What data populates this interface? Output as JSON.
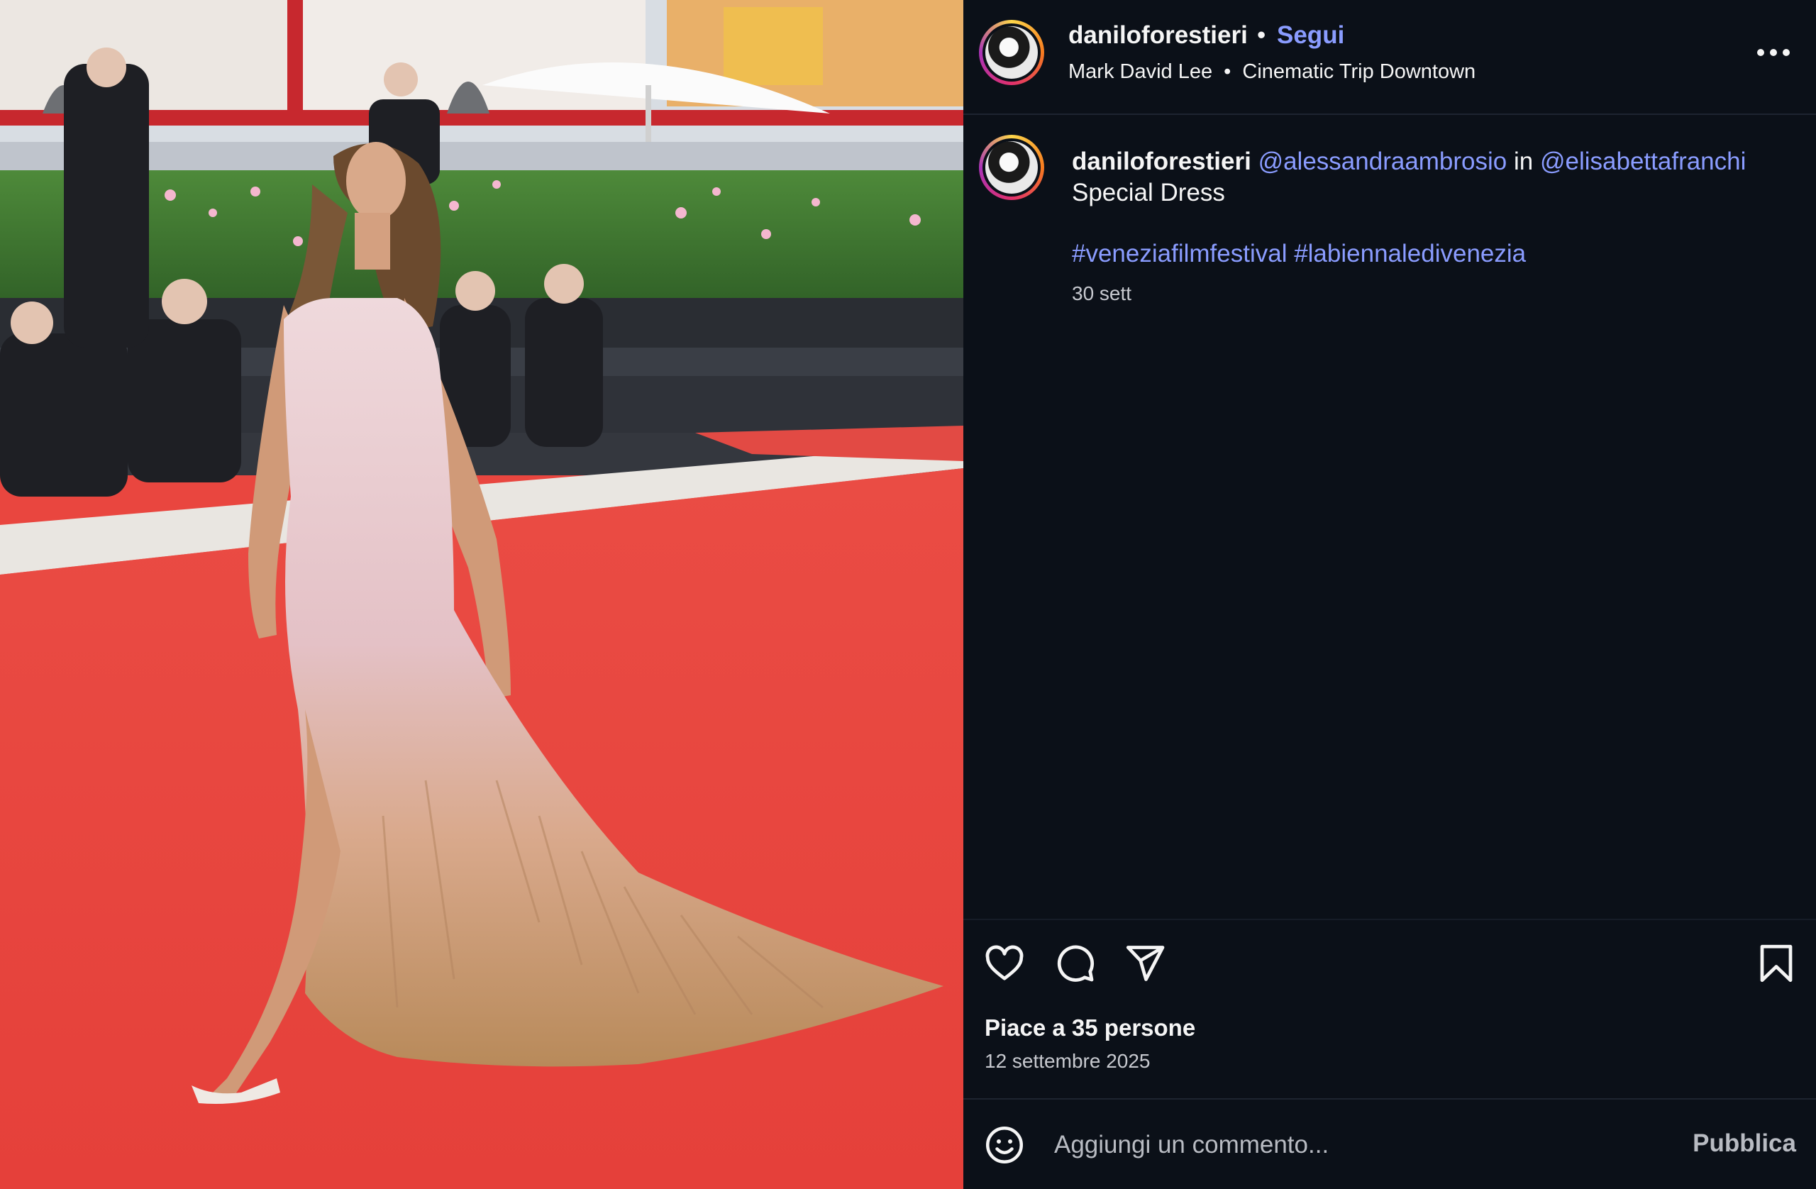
{
  "header": {
    "username": "daniloforestieri",
    "separator": "•",
    "follow_label": "Segui",
    "audio_artist": "Mark David Lee",
    "audio_title": "Cinematic Trip Downtown",
    "more_icon": "more-horizontal-icon"
  },
  "caption": {
    "username": "daniloforestieri",
    "mention_1": "@alessandraambrosio",
    "connector": "in",
    "mention_2": "@elisabettafranchi",
    "line2": "Special Dress",
    "hashtags": "#veneziafilmfestival #labiennaledivenezia",
    "time_ago": "30 sett"
  },
  "actions": {
    "like_icon": "heart-icon",
    "comment_icon": "comment-icon",
    "share_icon": "send-icon",
    "save_icon": "bookmark-icon",
    "likes_text": "Piace a 35 persone",
    "date_text": "12 settembre 2025"
  },
  "comment": {
    "emoji_icon": "emoji-icon",
    "placeholder": "Aggiungi un commento...",
    "publish_label": "Pubblica"
  },
  "colors": {
    "background": "#0b1018",
    "link": "#8a9cff",
    "red_carpet": "#e9463f"
  }
}
